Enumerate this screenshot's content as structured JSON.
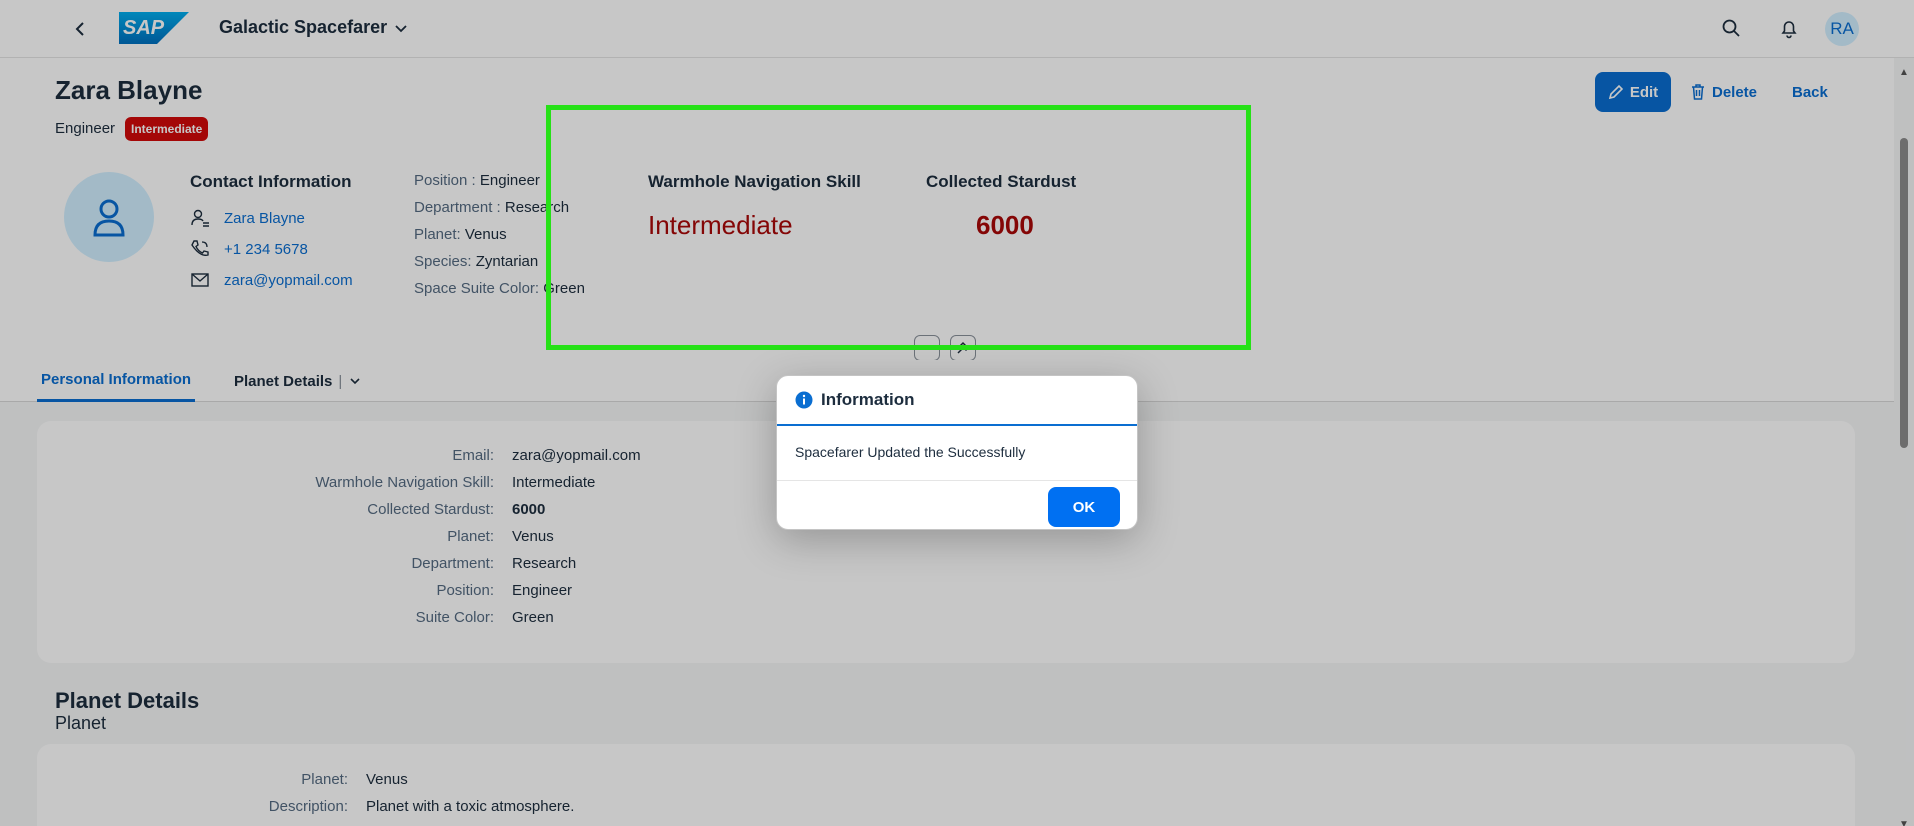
{
  "shell": {
    "app_title": "Galactic Spacefarer",
    "logo_text": "SAP",
    "user_initials": "RA"
  },
  "header": {
    "title": "Zara Blayne",
    "subtitle": "Engineer",
    "badge": "Intermediate",
    "actions": {
      "edit": "Edit",
      "delete": "Delete",
      "back": "Back"
    },
    "contact": {
      "title": "Contact Information",
      "name": "Zara Blayne",
      "phone": "+1 234 5678",
      "email": "zara@yopmail.com"
    },
    "attributes": [
      {
        "label": "Position :",
        "value": "Engineer"
      },
      {
        "label": "Department :",
        "value": "Research"
      },
      {
        "label": "Planet:",
        "value": "Venus"
      },
      {
        "label": "Species:",
        "value": "Zyntarian"
      },
      {
        "label": "Space Suite Color:",
        "value": "Green"
      }
    ],
    "kpis": {
      "skill_label": "Warmhole Navigation Skill",
      "skill_value": "Intermediate",
      "stardust_label": "Collected Stardust",
      "stardust_value": "6000"
    }
  },
  "tabs": [
    {
      "label": "Personal Information",
      "active": true
    },
    {
      "label": "Planet Details",
      "active": false
    }
  ],
  "personal_info": [
    {
      "label": "Email:",
      "value": "zara@yopmail.com"
    },
    {
      "label": "Warmhole Navigation Skill:",
      "value": "Intermediate"
    },
    {
      "label": "Collected Stardust:",
      "value": "6000"
    },
    {
      "label": "Planet:",
      "value": "Venus"
    },
    {
      "label": "Department:",
      "value": "Research"
    },
    {
      "label": "Position:",
      "value": "Engineer"
    },
    {
      "label": "Suite Color:",
      "value": "Green"
    }
  ],
  "planet_section": {
    "title": "Planet Details",
    "subtitle": "Planet",
    "rows": [
      {
        "label": "Planet:",
        "value": "Venus"
      },
      {
        "label": "Description:",
        "value": "Planet with a toxic atmosphere."
      }
    ]
  },
  "dialog": {
    "title": "Information",
    "message": "Spacefarer Updated the Successfully",
    "ok": "OK"
  },
  "colors": {
    "accent": "#0a6ed1",
    "critical": "#aa0808",
    "badge": "#d20a0a",
    "highlight": "#26e117"
  }
}
